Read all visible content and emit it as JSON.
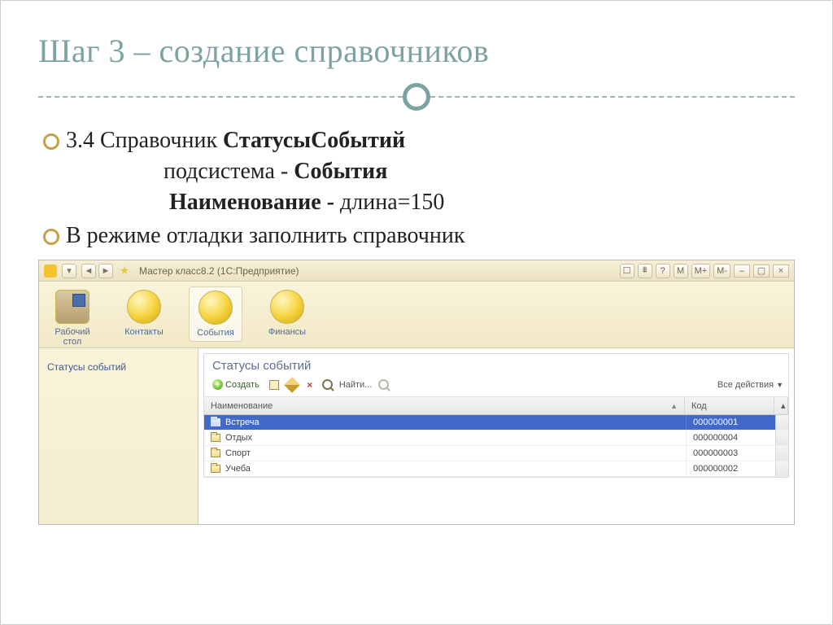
{
  "slide": {
    "title": "Шаг 3 – создание справочников",
    "line1_prefix": "3.4 Справочник  ",
    "line1_bold": "СтатусыСобытий",
    "line2_prefix": "подсистема -  ",
    "line2_bold": "События",
    "line3_bold": "Наименование  -",
    "line3_suffix": " длина=150",
    "line4": "В режиме отладки заполнить  справочник"
  },
  "app": {
    "window_title": "Мастер класс8.2  (1С:Предприятие)",
    "nav_back": "◄",
    "nav_fwd": "►",
    "right_chips": [
      "☐",
      "⩩",
      "?",
      "M",
      "M+",
      "M-"
    ],
    "win_min": "–",
    "win_max": "▢",
    "win_close": "×",
    "sections": [
      {
        "label": "Рабочий\nстол"
      },
      {
        "label": "Контакты"
      },
      {
        "label": "События"
      },
      {
        "label": "Финансы"
      }
    ],
    "side_link": "Статусы событий",
    "list": {
      "title": "Статусы событий",
      "create": "Создать",
      "search": "Найти...",
      "all_actions": "Все действия",
      "col_name": "Наименование",
      "col_code": "Код",
      "rows": [
        {
          "name": "Встреча",
          "code": "000000001",
          "selected": true
        },
        {
          "name": "Отдых",
          "code": "000000004",
          "selected": false
        },
        {
          "name": "Спорт",
          "code": "000000003",
          "selected": false
        },
        {
          "name": "Учеба",
          "code": "000000002",
          "selected": false
        }
      ]
    }
  }
}
